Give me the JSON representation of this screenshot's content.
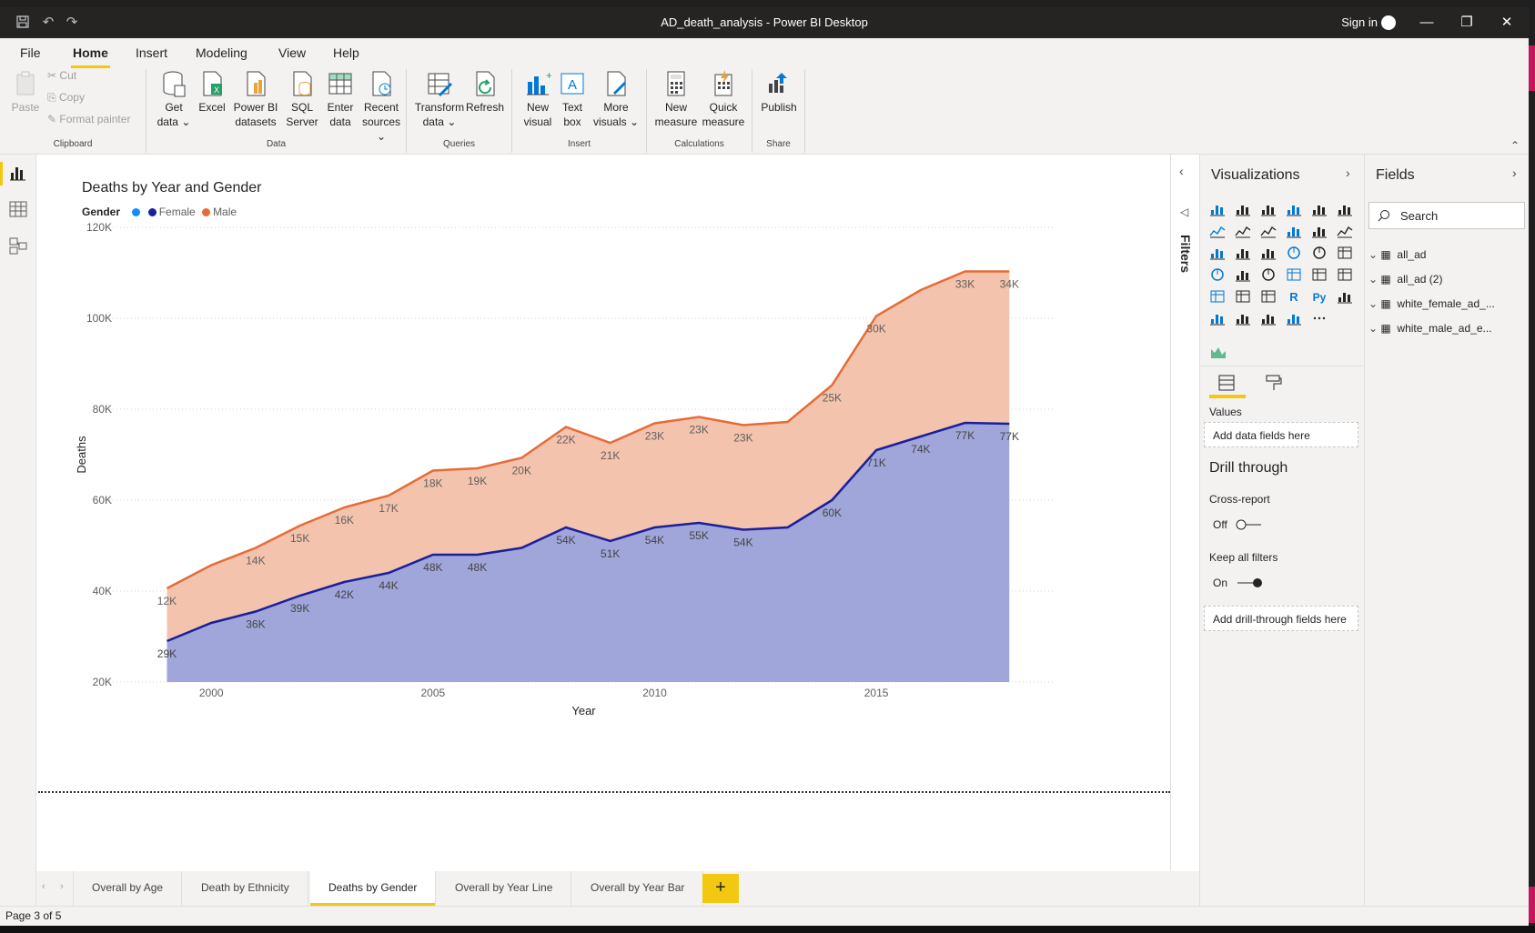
{
  "window": {
    "title": "AD_death_analysis - Power BI Desktop",
    "sign_in": "Sign in"
  },
  "menu": {
    "tabs": [
      "File",
      "Home",
      "Insert",
      "Modeling",
      "View",
      "Help"
    ],
    "active": "Home"
  },
  "ribbon": {
    "clipboard": {
      "label": "Clipboard",
      "paste": "Paste",
      "cut": "Cut",
      "copy": "Copy",
      "format_painter": "Format painter"
    },
    "data": {
      "label": "Data",
      "get_data": [
        "Get",
        "data"
      ],
      "excel": "Excel",
      "pbi_datasets": [
        "Power BI",
        "datasets"
      ],
      "sql_server": [
        "SQL",
        "Server"
      ],
      "enter_data": [
        "Enter",
        "data"
      ],
      "recent_sources": [
        "Recent",
        "sources"
      ]
    },
    "queries": {
      "label": "Queries",
      "transform_data": [
        "Transform",
        "data"
      ],
      "refresh": "Refresh"
    },
    "insert": {
      "label": "Insert",
      "new_visual": [
        "New",
        "visual"
      ],
      "text_box": [
        "Text",
        "box"
      ],
      "more_visuals": [
        "More",
        "visuals"
      ]
    },
    "calculations": {
      "label": "Calculations",
      "new_measure": [
        "New",
        "measure"
      ],
      "quick_measure": [
        "Quick",
        "measure"
      ]
    },
    "share": {
      "label": "Share",
      "publish": "Publish"
    }
  },
  "chart_data": {
    "type": "area",
    "title": "Deaths by Year and Gender",
    "legend_title": "Gender",
    "legend_placement": "top-left",
    "xlabel": "Year",
    "ylabel": "Deaths",
    "x": [
      1999,
      2000,
      2001,
      2002,
      2003,
      2004,
      2005,
      2006,
      2007,
      2008,
      2009,
      2010,
      2011,
      2012,
      2013,
      2014,
      2015,
      2016,
      2017,
      2018
    ],
    "x_ticks": [
      "2000",
      "2005",
      "2010",
      "2015"
    ],
    "y_ticks": [
      "20K",
      "40K",
      "60K",
      "80K",
      "100K",
      "120K"
    ],
    "ylim": [
      20000,
      120000
    ],
    "stacked": true,
    "grid": true,
    "series": [
      {
        "name": "Female",
        "color": "#1a1f9c",
        "fill": "#a0a6d9",
        "values": [
          29000,
          33000,
          35500,
          39000,
          42000,
          44000,
          48000,
          48000,
          49500,
          54000,
          51000,
          54000,
          55000,
          53500,
          54000,
          60000,
          71000,
          74000,
          77000,
          76800
        ],
        "labels": [
          "29K",
          "",
          "36K",
          "39K",
          "42K",
          "44K",
          "48K",
          "48K",
          "",
          "54K",
          "51K",
          "54K",
          "55K",
          "54K",
          "",
          "60K",
          "71K",
          "74K",
          "77K",
          "77K"
        ]
      },
      {
        "name": "Male",
        "color": "#e66c37",
        "fill": "#f4c3ae",
        "values": [
          11600,
          12700,
          14000,
          15400,
          16400,
          17000,
          18500,
          19000,
          19800,
          22100,
          21600,
          22900,
          23300,
          23000,
          23200,
          25300,
          29500,
          32200,
          33300,
          33500
        ],
        "labels": [
          "12K",
          "",
          "14K",
          "15K",
          "16K",
          "17K",
          "18K",
          "19K",
          "20K",
          "22K",
          "21K",
          "23K",
          "23K",
          "23K",
          "",
          "25K",
          "30K",
          "",
          "33K",
          "34K"
        ]
      }
    ]
  },
  "page_tabs": {
    "tabs": [
      "Overall by Age",
      "Death by Ethnicity",
      "Deaths by Gender",
      "Overall by Year Line",
      "Overall by Year Bar"
    ],
    "active": 2,
    "add": "+"
  },
  "status": {
    "page": "Page 3 of 5"
  },
  "filters": {
    "label": "Filters"
  },
  "visualizations": {
    "title": "Visualizations",
    "values_label": "Values",
    "add_data_fields": "Add data fields here",
    "drill_through": "Drill through",
    "cross_report": "Cross-report",
    "cross_report_state": "Off",
    "keep_all_filters": "Keep all filters",
    "keep_all_filters_state": "On",
    "add_drill_fields": "Add drill-through fields here"
  },
  "fields": {
    "title": "Fields",
    "search_placeholder": "Search",
    "tables": [
      "all_ad",
      "all_ad (2)",
      "white_female_ad_...",
      "white_male_ad_e..."
    ]
  },
  "colors": {
    "accent": "#f2c811",
    "female_legend": "#1a1f9c",
    "male_legend": "#e66c37",
    "female_dot_legend_title": "#118dff"
  }
}
